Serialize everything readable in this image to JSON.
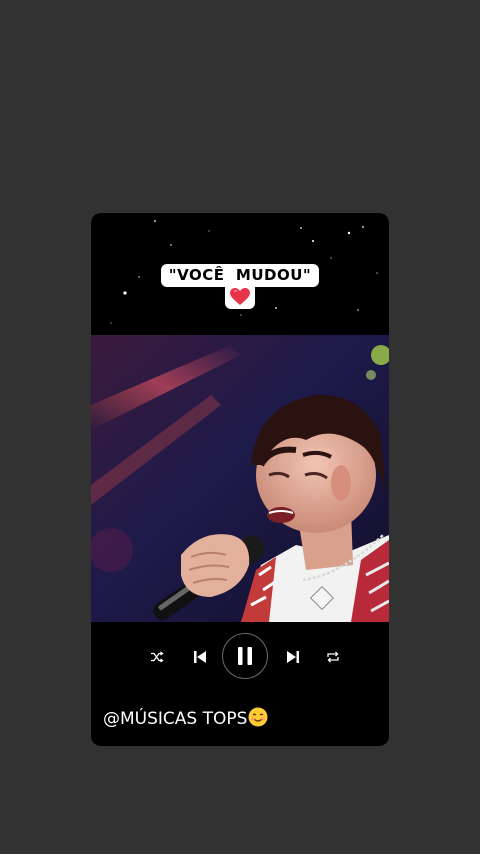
{
  "story": {
    "title": "\"VOCÊ  MUDOU\"",
    "heart_emoji": "❤️",
    "handle": "@MÚSICAS TOPS",
    "handle_emoji": "☺️"
  },
  "player": {
    "state": "playing",
    "controls": [
      "shuffle-icon",
      "previous-icon",
      "pause-icon",
      "next-icon",
      "repeat-icon"
    ]
  },
  "colors": {
    "background": "#333233",
    "card": "#000000",
    "pill": "#ffffff",
    "heart": "#e8334a"
  }
}
